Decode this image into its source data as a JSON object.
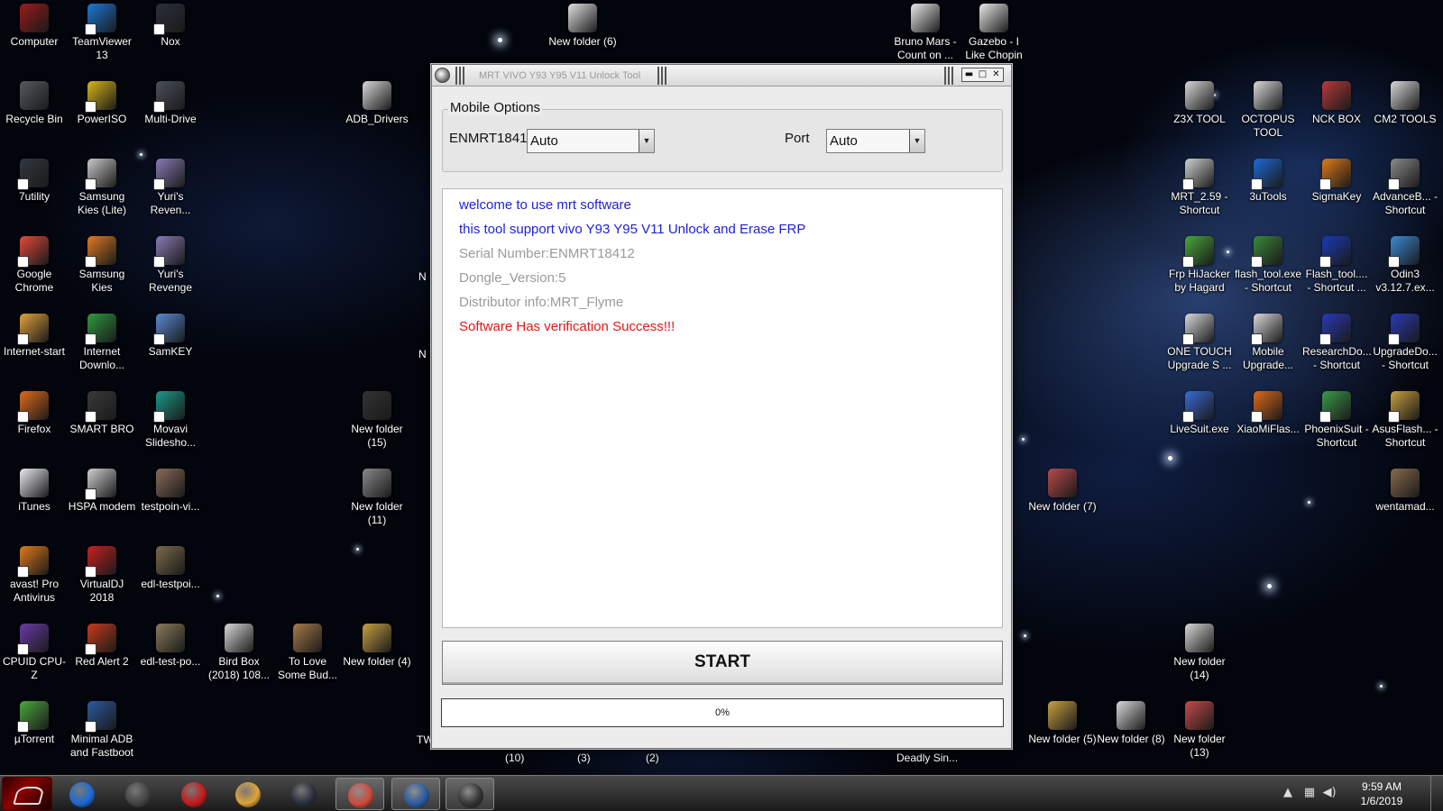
{
  "desktop": {
    "icons": [
      {
        "id": "computer",
        "label": "Computer",
        "color": "#9a1b1b",
        "icon": "computer-icon"
      },
      {
        "id": "teamviewer",
        "label": "TeamViewer 13",
        "color": "#1b78d6",
        "icon": "teamviewer-icon"
      },
      {
        "id": "nox",
        "label": "Nox",
        "color": "#2a2f3a",
        "icon": "nox-icon"
      },
      {
        "id": "recycle-bin",
        "label": "Recycle Bin",
        "color": "#555a60",
        "icon": "recycle-bin-icon"
      },
      {
        "id": "poweriso",
        "label": "PowerISO",
        "color": "#d9b51a",
        "icon": "poweriso-icon"
      },
      {
        "id": "multi-drive",
        "label": "Multi-Drive",
        "color": "#4a4f5a",
        "icon": "multi-drive-icon"
      },
      {
        "id": "7utility",
        "label": "7utility",
        "color": "#333840",
        "icon": "apps-icon"
      },
      {
        "id": "samsung-kies-lite",
        "label": "Samsung Kies (Lite)",
        "color": "#c9c9c9",
        "icon": "samsung-kies-icon"
      },
      {
        "id": "yuris-revenge-1",
        "label": "Yuri's Reven...",
        "color": "#8a7ab5",
        "icon": "yuri-icon"
      },
      {
        "id": "google-chrome",
        "label": "Google Chrome",
        "color": "#e04a3a",
        "icon": "chrome-icon"
      },
      {
        "id": "samsung-kies",
        "label": "Samsung Kies",
        "color": "#e07b22",
        "icon": "kies-icon"
      },
      {
        "id": "yuris-revenge-2",
        "label": "Yuri's Revenge",
        "color": "#8a7ab5",
        "icon": "yuri-icon"
      },
      {
        "id": "internet-start",
        "label": "Internet-start",
        "color": "#e0a33a",
        "icon": "chrome-icon"
      },
      {
        "id": "internet-download",
        "label": "Internet Downlo...",
        "color": "#2f9a3f",
        "icon": "idm-icon"
      },
      {
        "id": "samkey",
        "label": "SamKEY",
        "color": "#5a8ad6",
        "icon": "key-icon"
      },
      {
        "id": "firefox",
        "label": "Firefox",
        "color": "#e06a1a",
        "icon": "firefox-icon"
      },
      {
        "id": "smart-bro",
        "label": "SMART BRO",
        "color": "#3a3a3a",
        "icon": "smart-bro-icon"
      },
      {
        "id": "movavi",
        "label": "Movavi Slidesho...",
        "color": "#1a9a8a",
        "icon": "movavi-icon"
      },
      {
        "id": "itunes",
        "label": "iTunes",
        "color": "#e8e8f0",
        "icon": "itunes-icon"
      },
      {
        "id": "hspa-modem",
        "label": "HSPA modem",
        "color": "#d0d0d0",
        "icon": "modem-icon"
      },
      {
        "id": "testpoin-vi",
        "label": "testpoin-vi...",
        "color": "#8a6a5a",
        "icon": "image-icon"
      },
      {
        "id": "avast",
        "label": "avast! Pro Antivirus",
        "color": "#e07a1a",
        "icon": "avast-icon"
      },
      {
        "id": "virtualdj",
        "label": "VirtualDJ 2018",
        "color": "#c92020",
        "icon": "virtualdj-icon"
      },
      {
        "id": "edl-testpoi",
        "label": "edl-testpoi...",
        "color": "#7a6a4a",
        "icon": "image-icon"
      },
      {
        "id": "cpuid",
        "label": "CPUID CPU-Z",
        "color": "#6a3aa8",
        "icon": "cpuz-icon"
      },
      {
        "id": "red-alert",
        "label": "Red Alert 2",
        "color": "#c93a1a",
        "icon": "red-alert-icon"
      },
      {
        "id": "edl-test-po",
        "label": "edl-test-po...",
        "color": "#8a7a5a",
        "icon": "image-icon"
      },
      {
        "id": "utorrent",
        "label": "µTorrent",
        "color": "#4aa83a",
        "icon": "utorrent-icon"
      },
      {
        "id": "minimal-adb",
        "label": "Minimal ADB and Fastboot",
        "color": "#2a5aa0",
        "icon": "adb-icon"
      },
      {
        "id": "bird-box",
        "label": "Bird Box (2018) 108...",
        "color": "#d8d8d8",
        "icon": "folder-icon"
      },
      {
        "id": "to-love",
        "label": "To Love Some Bud...",
        "color": "#a87a4a",
        "icon": "image-icon"
      },
      {
        "id": "adb-drivers",
        "label": "ADB_Drivers",
        "color": "#d8d8d8",
        "icon": "folder-icon"
      },
      {
        "id": "new-folder-15",
        "label": "New folder (15)",
        "color": "#333",
        "icon": "folder-icon"
      },
      {
        "id": "new-folder-11",
        "label": "New folder (11)",
        "color": "#8a8a8a",
        "icon": "folder-icon"
      },
      {
        "id": "new-folder-4",
        "label": "New folder (4)",
        "color": "#c8a040",
        "icon": "folder-icon"
      },
      {
        "id": "new-folder-6",
        "label": "New folder (6)",
        "color": "#e0e0e0",
        "icon": "folder-icon"
      },
      {
        "id": "bruno-mars",
        "label": "Bruno Mars - Count on ...",
        "color": "#e8e8e8",
        "icon": "mp3-icon"
      },
      {
        "id": "gazebo",
        "label": "Gazebo - I Like Chopin",
        "color": "#e8e8e8",
        "icon": "mp3-icon"
      },
      {
        "id": "z3x-tool",
        "label": "Z3X TOOL",
        "color": "#d8d8d8",
        "icon": "folder-icon"
      },
      {
        "id": "octopus-tool",
        "label": "OCTOPUS TOOL",
        "color": "#d8d8d8",
        "icon": "folder-icon"
      },
      {
        "id": "nck-box",
        "label": "NCK BOX",
        "color": "#b83a3a",
        "icon": "folder-icon"
      },
      {
        "id": "cm2-tools",
        "label": "CM2 TOOLS",
        "color": "#d8d8d8",
        "icon": "folder-icon"
      },
      {
        "id": "mrt-259",
        "label": "MRT_2.59 - Shortcut",
        "color": "#d0d0d0",
        "icon": "mrt-icon"
      },
      {
        "id": "3utools",
        "label": "3uTools",
        "color": "#1a6ad6",
        "icon": "3utools-icon"
      },
      {
        "id": "sigmakey",
        "label": "SigmaKey",
        "color": "#e07a1a",
        "icon": "sigmakey-icon"
      },
      {
        "id": "advanceb",
        "label": "AdvanceB... - Shortcut",
        "color": "#8a8a8a",
        "icon": "advance-box-icon"
      },
      {
        "id": "frp-hijacker",
        "label": "Frp HiJacker by Hagard",
        "color": "#4aa83a",
        "icon": "frp-icon"
      },
      {
        "id": "flash-tool-exe",
        "label": "flash_tool.exe - Shortcut",
        "color": "#3a8a3a",
        "icon": "flash-tool-icon"
      },
      {
        "id": "flash-tool-2",
        "label": "Flash_tool.... - Shortcut ...",
        "color": "#1a3ab8",
        "icon": "flash-tool-icon"
      },
      {
        "id": "odin3",
        "label": "Odin3 v3.12.7.ex...",
        "color": "#3a8ad6",
        "icon": "odin-icon"
      },
      {
        "id": "one-touch",
        "label": "ONE TOUCH Upgrade S ...",
        "color": "#d8d8d8",
        "icon": "gear-icon"
      },
      {
        "id": "mobile-upgrade",
        "label": "Mobile Upgrade...",
        "color": "#d8d8d8",
        "icon": "gear-icon"
      },
      {
        "id": "researchdo",
        "label": "ResearchDo... - Shortcut",
        "color": "#2a3ab8",
        "icon": "research-icon"
      },
      {
        "id": "upgradedo",
        "label": "UpgradeDo... - Shortcut",
        "color": "#2a3ab8",
        "icon": "upgrade-icon"
      },
      {
        "id": "livesuit",
        "label": "LiveSuit.exe",
        "color": "#3a6ad6",
        "icon": "livesuit-icon"
      },
      {
        "id": "xiaomiflash",
        "label": "XiaoMiFlas...",
        "color": "#e06a1a",
        "icon": "xiaomi-icon"
      },
      {
        "id": "phoenixsuit",
        "label": "PhoenixSuit - Shortcut",
        "color": "#3a9a4a",
        "icon": "phoenix-icon"
      },
      {
        "id": "asusflash",
        "label": "AsusFlash... - Shortcut",
        "color": "#c8a040",
        "icon": "asus-icon"
      },
      {
        "id": "new-folder-7",
        "label": "New folder (7)",
        "color": "#b84a4a",
        "icon": "folder-icon"
      },
      {
        "id": "wentamad",
        "label": "wentamad...",
        "color": "#8a6a4a",
        "icon": "image-icon"
      },
      {
        "id": "new-folder-14",
        "label": "New folder (14)",
        "color": "#d8d8d8",
        "icon": "folder-icon"
      },
      {
        "id": "new-folder-5",
        "label": "New folder (5)",
        "color": "#c8a040",
        "icon": "folder-icon"
      },
      {
        "id": "new-folder-8",
        "label": "New folder (8)",
        "color": "#d8d8d8",
        "icon": "folder-icon"
      },
      {
        "id": "new-folder-13",
        "label": "New folder (13)",
        "color": "#c84a4a",
        "icon": "folder-icon"
      }
    ],
    "partial_labels": {
      "n1": "N",
      "n2": "N",
      "tw": "TW",
      "p10": "(10)",
      "p3": "(3)",
      "p2": "(2)",
      "deadly": "Deadly Sin..."
    }
  },
  "app": {
    "title": "MRT VIVO Y93 Y95 V11 Unlock Tool",
    "window_controls": {
      "minimize": "▬",
      "maximize": "□",
      "close": "✕"
    },
    "mobile_options": {
      "legend": "Mobile Options",
      "serial_label": "ENMRT1841",
      "serial_combo_value": "Auto",
      "port_label": "Port",
      "port_combo_value": "Auto"
    },
    "log": [
      {
        "text": "welcome to use mrt software",
        "color": "#1f1fd6"
      },
      {
        "text": "this tool support vivo Y93 Y95 V11 Unlock and Erase FRP",
        "color": "#1f1fd6"
      },
      {
        "text": "Serial Number:ENMRT18412",
        "color": "#9a9a9a"
      },
      {
        "text": "Dongle_Version:5",
        "color": "#9a9a9a"
      },
      {
        "text": "Distributor info:MRT_Flyme",
        "color": "#9a9a9a"
      },
      {
        "text": "Software Has verification Success!!!",
        "color": "#e01818"
      }
    ],
    "start_label": "START",
    "progress": {
      "value": 0,
      "label": "0%"
    }
  },
  "taskbar": {
    "buttons": [
      {
        "id": "media-player",
        "color": "#1a6ad6",
        "icon": "media-player-icon"
      },
      {
        "id": "camera",
        "color": "#444",
        "icon": "camera-icon"
      },
      {
        "id": "red-app",
        "color": "#c81a1a",
        "icon": "red-app-icon"
      },
      {
        "id": "chrome",
        "color": "#e0a33a",
        "icon": "chrome-icon"
      },
      {
        "id": "nox",
        "color": "#2a2f3a",
        "icon": "nox-icon"
      },
      {
        "id": "chrome-profile",
        "color": "#d04a3a",
        "icon": "chrome-icon",
        "active": true
      },
      {
        "id": "mrt-tool",
        "color": "#2a5aa0",
        "icon": "mrt-window-icon",
        "active": true
      },
      {
        "id": "task-switch",
        "color": "#333",
        "icon": "switch-icon",
        "active": true
      }
    ],
    "clock": {
      "time": "9:59 AM",
      "date": "1/6/2019"
    }
  }
}
